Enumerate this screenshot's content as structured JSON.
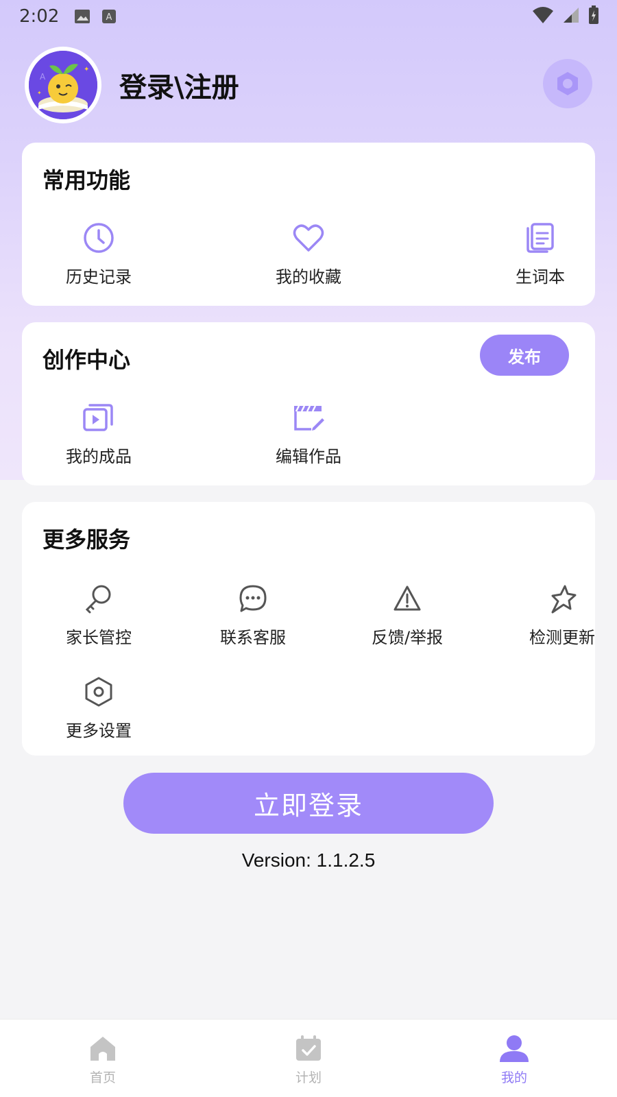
{
  "status_bar": {
    "time": "2:02"
  },
  "header": {
    "login_text": "登录\\注册"
  },
  "common_functions": {
    "title": "常用功能",
    "items": [
      {
        "label": "历史记录",
        "icon": "clock-icon"
      },
      {
        "label": "我的收藏",
        "icon": "heart-icon"
      },
      {
        "label": "生词本",
        "icon": "notebook-icon"
      }
    ]
  },
  "creation_center": {
    "title": "创作中心",
    "publish_label": "发布",
    "items": [
      {
        "label": "我的成品",
        "icon": "video-stack-icon"
      },
      {
        "label": "编辑作品",
        "icon": "clapperboard-edit-icon"
      }
    ]
  },
  "more_services": {
    "title": "更多服务",
    "items": [
      {
        "label": "家长管控",
        "icon": "key-icon"
      },
      {
        "label": "联系客服",
        "icon": "chat-bubble-icon"
      },
      {
        "label": "反馈/举报",
        "icon": "warning-icon"
      },
      {
        "label": "检测更新",
        "icon": "star-icon"
      },
      {
        "label": "更多设置",
        "icon": "hexagon-settings-icon"
      }
    ]
  },
  "login_button": "立即登录",
  "version": "Version: 1.1.2.5",
  "tabbar": {
    "tabs": [
      {
        "label": "首页",
        "icon": "home-icon",
        "active": false
      },
      {
        "label": "计划",
        "icon": "calendar-check-icon",
        "active": false
      },
      {
        "label": "我的",
        "icon": "person-icon",
        "active": true
      }
    ]
  },
  "colors": {
    "accent": "#9b85f7",
    "icon_purple": "#9b87f5",
    "icon_gray": "#555555"
  }
}
